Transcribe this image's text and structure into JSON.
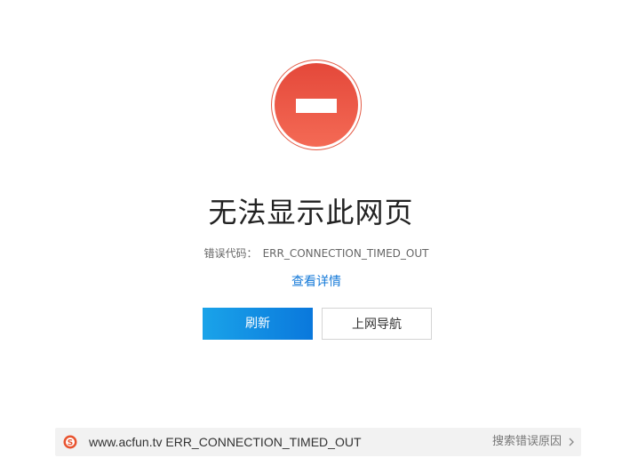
{
  "error_page": {
    "title": "无法显示此网页",
    "error_code_label": "错误代码：",
    "error_code_value": "ERR_CONNECTION_TIMED_OUT",
    "details_link": "查看详情",
    "refresh_button": "刷新",
    "nav_button": "上网导航"
  },
  "search_bar": {
    "url_text": "www.acfun.tv ERR_CONNECTION_TIMED_OUT",
    "reason_link": "搜索错误原因",
    "logo_icon": "sogou-logo-icon",
    "chevron_icon": "chevron-right-icon"
  },
  "colors": {
    "stop_sign": "#e4483a",
    "refresh_button": "#0a78dc",
    "link": "#1479d8"
  }
}
